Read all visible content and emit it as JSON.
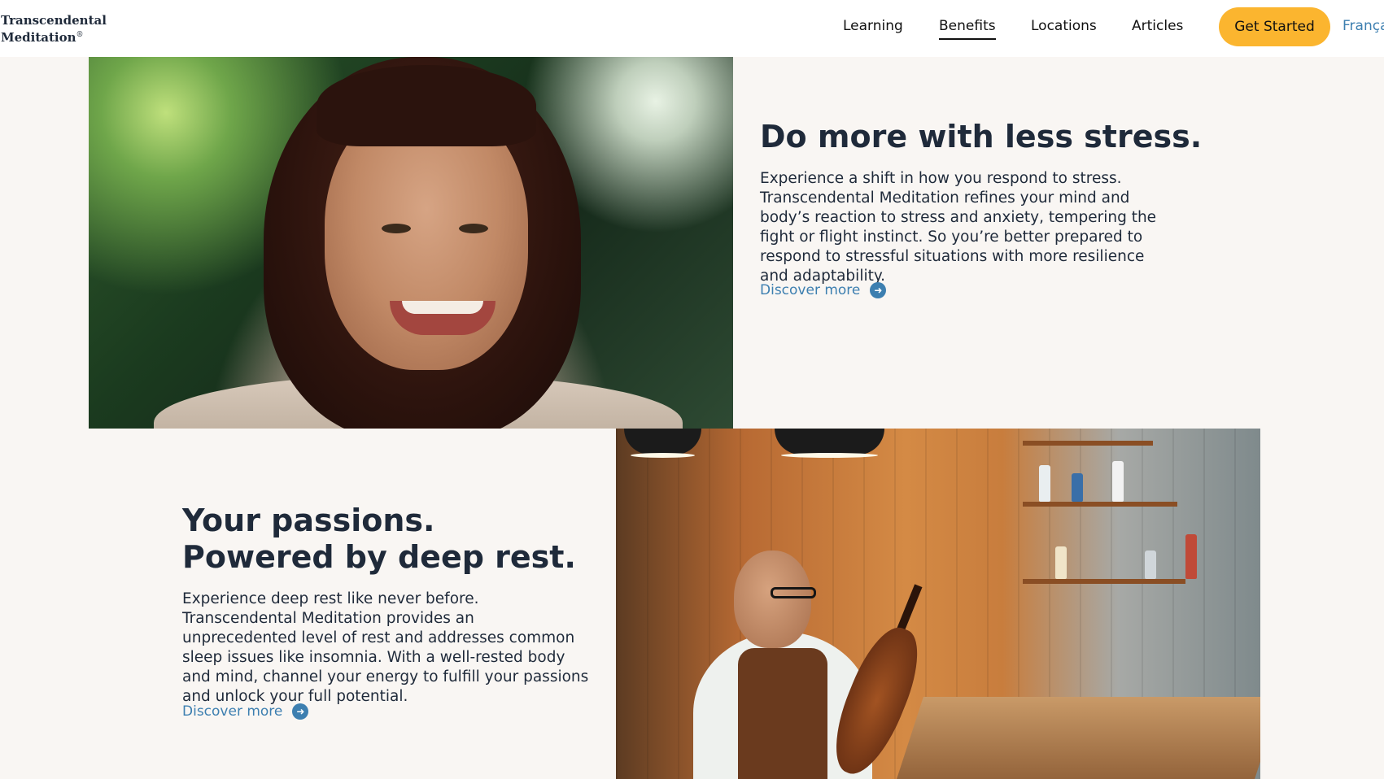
{
  "header": {
    "logo_line1": "Transcendental",
    "logo_line2": "Meditation",
    "logo_reg": "®",
    "nav": [
      "Learning",
      "Benefits",
      "Locations",
      "Articles"
    ],
    "active_nav": "Benefits",
    "cta_label": "Get Started",
    "language": "Français"
  },
  "section_stress": {
    "heading": "Do more with less stress.",
    "body": "Experience a shift in how you respond to stress. Transcendental Meditation refines your mind and body’s reaction to stress and anxiety, tempering the fight or flight instinct. So you’re better prepared to respond to stressful situations with more resilience and adaptability.",
    "link_label": "Discover more"
  },
  "section_rest": {
    "heading_line1": "Your passions.",
    "heading_line2": "Powered by deep rest.",
    "body": "Experience deep rest like never before. Transcendental Meditation provides an unprecedented level of rest and addresses common sleep issues like insomnia. With a well-rested body and mind, channel your energy to fulfill your passions and unlock your full potential.",
    "link_label": "Discover more"
  },
  "colors": {
    "accent": "#fbb52f",
    "link": "#3d7fb0",
    "heading": "#1f2a3a",
    "background": "#f9f6f3"
  },
  "icons": {
    "discover_more": "arrow-right-circle-icon"
  }
}
